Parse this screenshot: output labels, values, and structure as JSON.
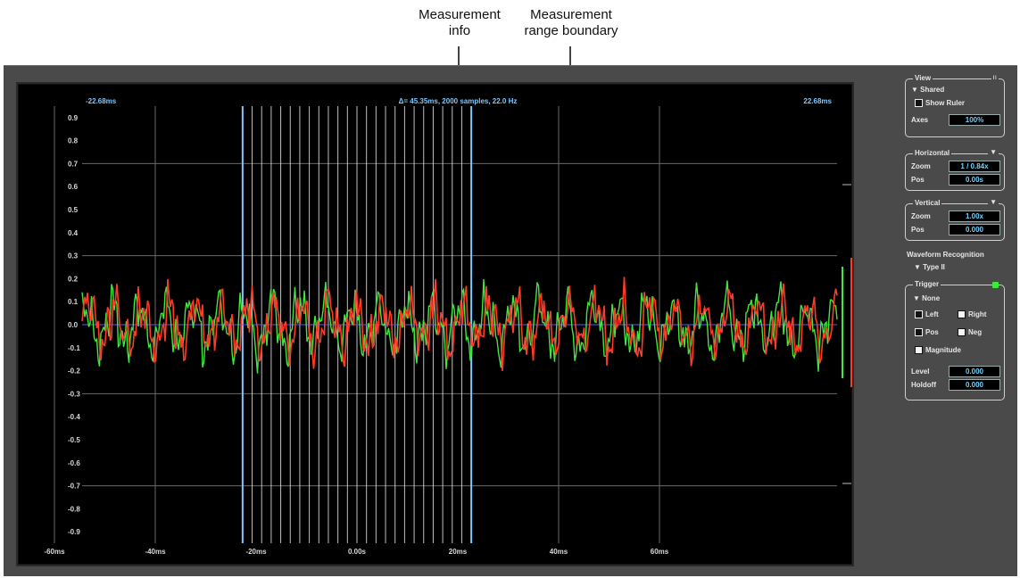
{
  "annotations": {
    "measurement_info": [
      "Measurement",
      "info"
    ],
    "measurement_range": [
      "Measurement",
      "range boundary"
    ]
  },
  "scope": {
    "left_time": "-22.68ms",
    "right_time": "22.68ms",
    "measure_text": "Δ= 45.35ms, 2000 samples, 22.0 Hz",
    "y_labels": [
      "0.9",
      "0.8",
      "0.7",
      "0.6",
      "0.5",
      "0.4",
      "0.3",
      "0.2",
      "0.1",
      "0.0",
      "-0.1",
      "-0.2",
      "-0.3",
      "-0.4",
      "-0.5",
      "-0.6",
      "-0.7",
      "-0.8",
      "-0.9"
    ],
    "x_labels": [
      "-60ms",
      "-40ms",
      "-20ms",
      "0.00s",
      "20ms",
      "40ms",
      "60ms"
    ],
    "colors": {
      "left_channel": "#3ee83e",
      "right_channel": "#ff3b28",
      "axis_text": "#d8d8d8",
      "accent": "#7fc8ff",
      "zero_line": "#5b5bff"
    }
  },
  "panel": {
    "view": {
      "title": "View",
      "shared": "▼ Shared",
      "show_ruler": "Show Ruler",
      "axes_label": "Axes",
      "axes_value": "100%"
    },
    "horizontal": {
      "title": "Horizontal",
      "zoom_label": "Zoom",
      "zoom_value": "1 / 0.84x",
      "pos_label": "Pos",
      "pos_value": "0.00s"
    },
    "vertical": {
      "title": "Vertical",
      "zoom_label": "Zoom",
      "zoom_value": "1.00x",
      "pos_label": "Pos",
      "pos_value": "0.000"
    },
    "waveform": {
      "label": "Waveform Recognition",
      "type": "▼ Type II"
    },
    "trigger": {
      "title": "Trigger",
      "mode": "▼ None",
      "left": "Left",
      "right": "Right",
      "pos": "Pos",
      "neg": "Neg",
      "magnitude": "Magnitude",
      "level_label": "Level",
      "level_value": "0.000",
      "holdoff_label": "Holdoff",
      "holdoff_value": "0.000"
    }
  }
}
